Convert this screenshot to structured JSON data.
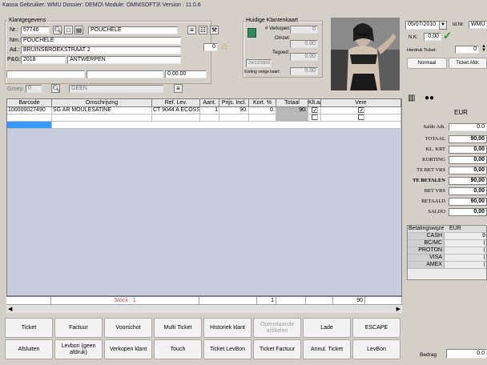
{
  "title": "Kassa   Gebruiker: WMU   Dossier: DEMO\\   Module: OMNISOFT3\\   Version : 11.0.6",
  "klant": {
    "group_title": "Klantgegevens",
    "nr_label": "Nr.:",
    "nr_value": "57746",
    "name_code": "POUCHELE",
    "nm_label": "Nm.:",
    "nm_value": "POUCHELE",
    "ad_label": "Ad.:",
    "ad_value": "BRUINSBROEKSTRAAT 2",
    "pg_label": "P&G:",
    "postcode": "2018",
    "gemeente": "ANTWERPEN",
    "amount_field": "0.00.00",
    "groep_label": "Groep:",
    "groep_value": "0",
    "groep_name": "GEEN",
    "small_field": "0"
  },
  "huidige": {
    "title": "Huidige Klantenkaart",
    "verkopen_label": "# Verkopen:",
    "verkopen_value": "0",
    "omzet_label": "Omzet:",
    "omzet_value": "0.00",
    "tegoed_label": "Tegoed:",
    "tegoed_value": "0.00",
    "date_value": "24/12/2800",
    "korting_label": "Korting vorige kaart:",
    "korting_value": "0.00"
  },
  "right_top": {
    "date": "05/07/2010",
    "id_label": "Id.Nr:",
    "id_value": "WMU",
    "nk_label": "N.K:",
    "nk_value": "0,00",
    "ticket_label": "Herdruk Ticket:",
    "ticket_value": "0",
    "normal_btn": "Normaal",
    "ticket_afdr_btn": "Ticket Afdr."
  },
  "grid": {
    "headers": [
      "Barcode",
      "Omschrijving",
      "Ref. Lev.",
      "Aant.",
      "Prijs. Incl.",
      "Kort. %",
      "Totaal",
      "Klt.aa",
      "Vere"
    ],
    "rows": [
      {
        "barcode": "100000027490",
        "omschrijving": "SG AR MOULESATINE",
        "ref": "CT 9044 A ECOSSA",
        "aant": "1",
        "prijs": "90.",
        "kort": "0.",
        "totaal": "90.",
        "klt": "✓",
        "vere": "✓"
      }
    ],
    "footer": {
      "stock": "Stock : 1",
      "aant": "1",
      "totaal": "90"
    }
  },
  "totals": {
    "currency": "EUR",
    "saldo_label": "Saldo Ath.",
    "saldo_value": "0.0",
    "rows": [
      {
        "label": "TOTAAL",
        "value": "90,00",
        "bold": true
      },
      {
        "label": "KL. KRT",
        "value": "0,00",
        "bold": true
      },
      {
        "label": "KORTING",
        "value": "0,00",
        "bold": true
      },
      {
        "label": "TE BET VRS",
        "value": "0,00",
        "bold": true
      },
      {
        "label": "TE BETALEN",
        "value": "90,00",
        "bold": true
      },
      {
        "label": "BET VRS",
        "value": "0,00",
        "bold": true
      },
      {
        "label": "BETAALD",
        "value": "90,00",
        "bold": true
      },
      {
        "label": "SALDO",
        "value": "0,00",
        "bold": true
      }
    ]
  },
  "payment": {
    "header_label": "Betalingswijze",
    "header_cur": "EUR",
    "rows": [
      {
        "label": "CASH",
        "value": "9"
      },
      {
        "label": "BC/MC",
        "value": "("
      },
      {
        "label": "PROTON",
        "value": "("
      },
      {
        "label": "VISA",
        "value": "("
      },
      {
        "label": "AMEX",
        "value": "("
      }
    ]
  },
  "bedrag": {
    "label": "Bedrag",
    "value": "0.0"
  },
  "buttons_row1": [
    "Ticket",
    "Factuur",
    "Voorschot",
    "Multi Ticket",
    "Historiek klant",
    "Openstaande artikelen",
    "Lade",
    "ESCAPE"
  ],
  "buttons_row2": [
    "Afsluiten",
    "Levbon (geen afdruk)",
    "Verkopen klant",
    "Touch",
    "Ticket LevBon",
    "Ticket Factuur",
    "Annul. Ticket",
    "LevBon"
  ],
  "colors": {
    "background": "#d4d0c8",
    "grid_empty": "#c8cbe0",
    "selection": "#3399ff",
    "total_cell": "#b8b8b8"
  }
}
